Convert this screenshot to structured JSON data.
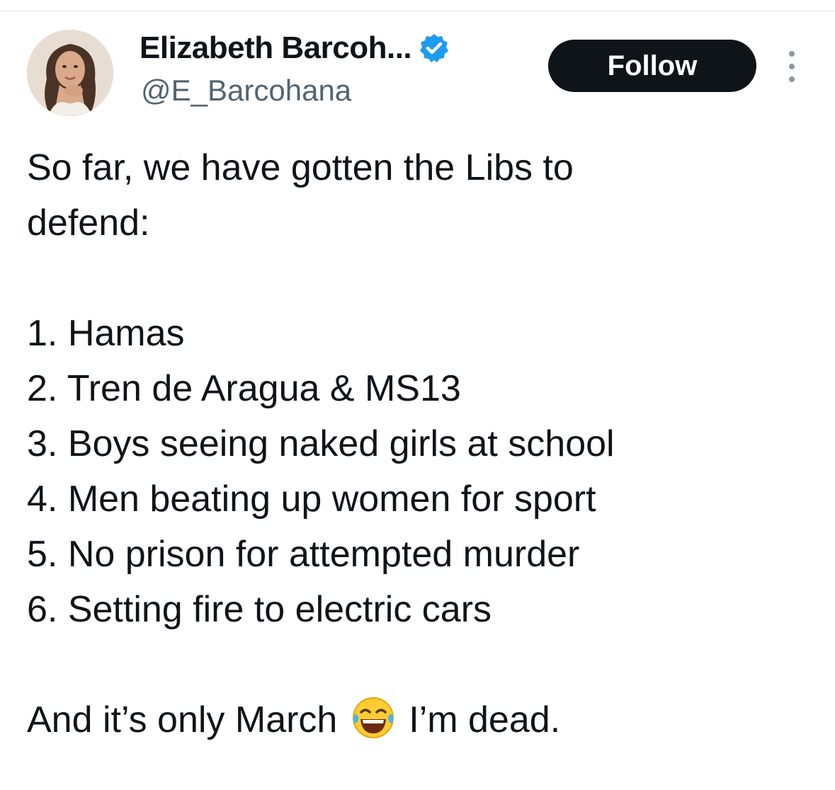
{
  "tweet": {
    "author": {
      "display_name": "Elizabeth Barcoh...",
      "handle": "@E_Barcohana",
      "verified": true,
      "verified_icon": "verified-badge-icon"
    },
    "actions": {
      "follow_label": "Follow",
      "more_icon": "more-vertical-icon"
    },
    "body": {
      "intro_line1": "So far, we have gotten the Libs to",
      "intro_line2": "defend:",
      "list": [
        "1. Hamas",
        "2. Tren de Aragua & MS13",
        "3. Boys seeing naked girls at school",
        "4. Men beating up women for sport",
        "5. No prison for attempted murder",
        "6. Setting fire to electric cars"
      ],
      "closing_before_emoji": "And it’s only March",
      "emoji_icon": "face-with-tears-of-joy-icon",
      "closing_after_emoji": "I’m dead."
    },
    "colors": {
      "text": "#0f1419",
      "secondary_text": "#536471",
      "verified_blue": "#1d9bf0",
      "follow_bg": "#0f1419"
    }
  }
}
